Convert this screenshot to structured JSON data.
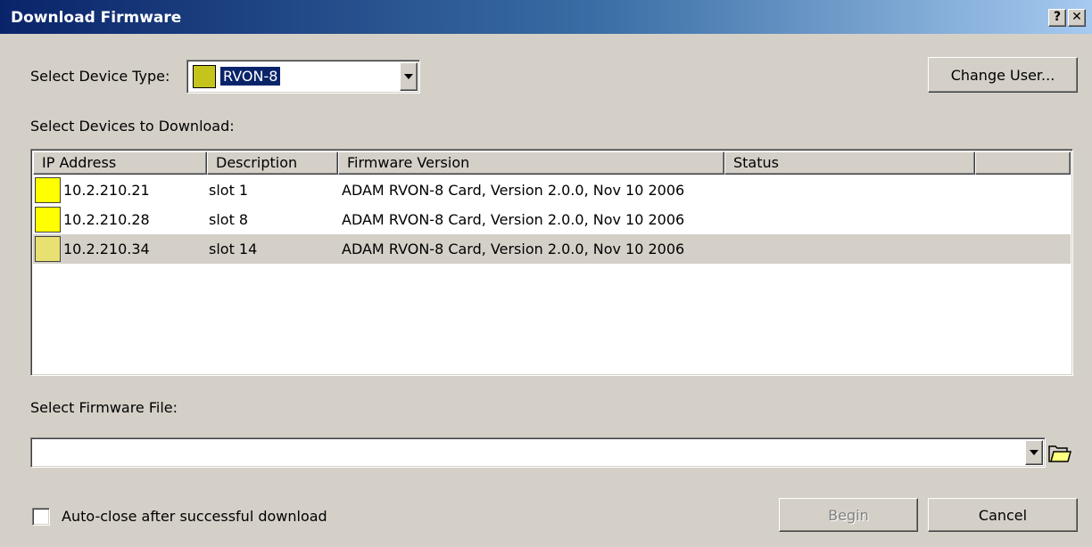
{
  "window": {
    "title": "Download Firmware",
    "help_button": "?",
    "close_button": "✕"
  },
  "device_type": {
    "label": "Select Device Type:",
    "value": "RVON-8",
    "swatch_color": "#c4c41c"
  },
  "change_user_button": "Change User...",
  "devices": {
    "label": "Select Devices to Download:",
    "columns": [
      "IP Address",
      "Description",
      "Firmware Version",
      "Status",
      ""
    ],
    "rows": [
      {
        "ip": "10.2.210.21",
        "description": "slot 1",
        "firmware": "ADAM RVON-8 Card, Version 2.0.0, Nov 10 2006",
        "status": "",
        "color": "#ffff00"
      },
      {
        "ip": "10.2.210.28",
        "description": "slot 8",
        "firmware": "ADAM RVON-8 Card, Version 2.0.0, Nov 10 2006",
        "status": "",
        "color": "#ffff00"
      },
      {
        "ip": "10.2.210.34",
        "description": "slot 14",
        "firmware": "ADAM RVON-8 Card, Version 2.0.0, Nov 10 2006",
        "status": "",
        "color": "#e8e070"
      }
    ]
  },
  "firmware_file": {
    "label": "Select Firmware File:",
    "value": ""
  },
  "auto_close": {
    "label": "Auto-close after successful download",
    "checked": false
  },
  "begin_button": "Begin",
  "cancel_button": "Cancel"
}
